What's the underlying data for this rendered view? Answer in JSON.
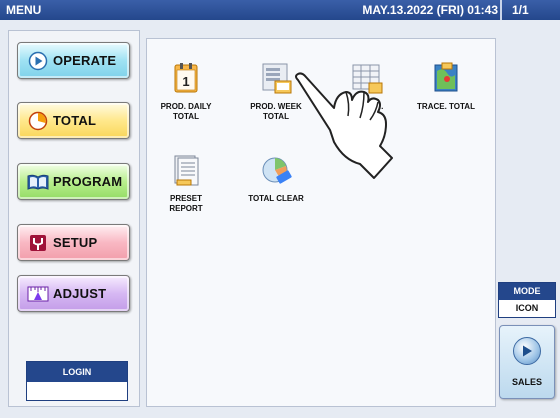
{
  "titlebar": {
    "title": "MENU",
    "datetime": "MAY.13.2022 (FRI) 01:43",
    "page": "1/1"
  },
  "left_menu": {
    "operate": {
      "label": "OPERATE",
      "icon": "operate-circle-icon"
    },
    "total": {
      "label": "TOTAL",
      "icon": "total-clock-icon"
    },
    "program": {
      "label": "PROGRAM",
      "icon": "program-book-icon"
    },
    "setup": {
      "label": "SETUP",
      "icon": "setup-wrench-icon"
    },
    "adjust": {
      "label": "ADJUST",
      "icon": "adjust-scale-icon"
    }
  },
  "login": {
    "label": "LOGIN",
    "value": ""
  },
  "tiles": [
    {
      "label": "PROD. DAILY\nTOTAL",
      "icon": "calendar-icon"
    },
    {
      "label": "PROD. WEEK\nTOTAL",
      "icon": "weekly-report-icon"
    },
    {
      "label": "UM.",
      "icon": "spreadsheet-icon"
    },
    {
      "label": "TRACE. TOTAL",
      "icon": "trace-map-icon"
    },
    {
      "label": "PRESET\nREPORT",
      "icon": "report-document-icon"
    },
    {
      "label": "TOTAL CLEAR",
      "icon": "clear-eraser-icon"
    }
  ],
  "mode": {
    "label": "MODE",
    "value": "ICON"
  },
  "sales": {
    "label": "SALES",
    "icon": "play-circle-icon"
  },
  "colors": {
    "titlebar": "#24478c",
    "operate": "#9fe2f3",
    "total": "#ffe88c",
    "program": "#b9ee8e",
    "setup": "#f9b8c3",
    "adjust": "#d6b8f3"
  }
}
